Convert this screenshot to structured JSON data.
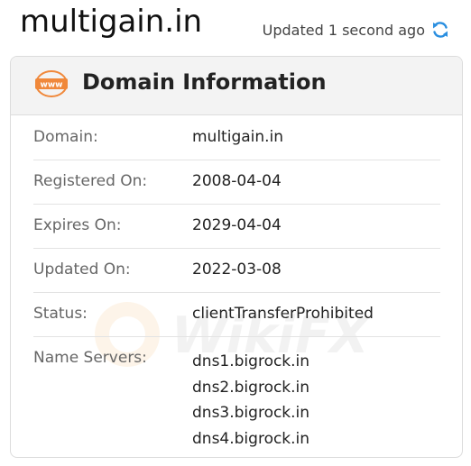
{
  "site": {
    "title": "multigain.in",
    "updated_text": "Updated 1 second ago"
  },
  "card": {
    "title": "Domain Information",
    "icon_text": "www",
    "rows": [
      {
        "label": "Domain:",
        "value": "multigain.in"
      },
      {
        "label": "Registered On:",
        "value": "2008-04-04"
      },
      {
        "label": "Expires On:",
        "value": "2029-04-04"
      },
      {
        "label": "Updated On:",
        "value": "2022-03-08"
      },
      {
        "label": "Status:",
        "value": "clientTransferProhibited"
      }
    ],
    "name_servers": {
      "label": "Name Servers:",
      "values": [
        "dns1.bigrock.in",
        "dns2.bigrock.in",
        "dns3.bigrock.in",
        "dns4.bigrock.in"
      ]
    }
  },
  "watermark": {
    "text": "WikiFX"
  },
  "colors": {
    "accent_orange": "#f0883a",
    "refresh_blue": "#2b8fe0"
  },
  "icons": {
    "refresh": "refresh-icon",
    "www": "www-icon"
  }
}
